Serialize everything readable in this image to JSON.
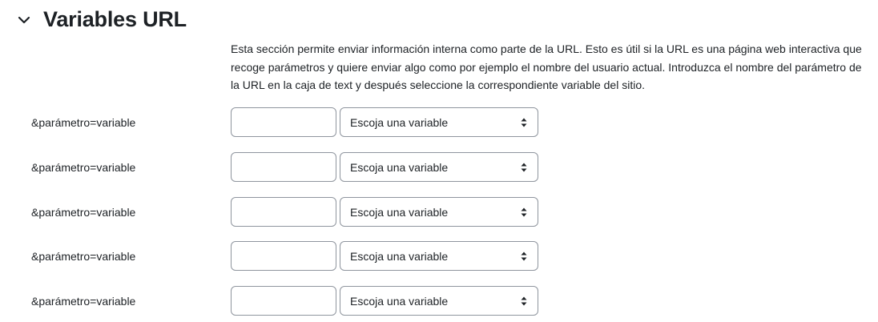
{
  "section": {
    "title": "Variables URL",
    "description": "Esta sección permite enviar información interna como parte de la URL. Esto es útil si la URL es una página web interactiva que recoge parámetros y quiere enviar algo como por ejemplo el nombre del usuario actual. Introduzca el nombre del parámetro de la URL en la caja de text y después seleccione la correspondiente variable del sitio.",
    "expanded": true
  },
  "rows": [
    {
      "label": "&parámetro=variable",
      "param_value": "",
      "select_value": "Escoja una variable"
    },
    {
      "label": "&parámetro=variable",
      "param_value": "",
      "select_value": "Escoja una variable"
    },
    {
      "label": "&parámetro=variable",
      "param_value": "",
      "select_value": "Escoja una variable"
    },
    {
      "label": "&parámetro=variable",
      "param_value": "",
      "select_value": "Escoja una variable"
    },
    {
      "label": "&parámetro=variable",
      "param_value": "",
      "select_value": "Escoja una variable"
    }
  ],
  "icons": {
    "collapse": "chevron-down-icon",
    "select": "sort-icon"
  },
  "colors": {
    "text": "#1d2125",
    "border": "#8f959e"
  }
}
